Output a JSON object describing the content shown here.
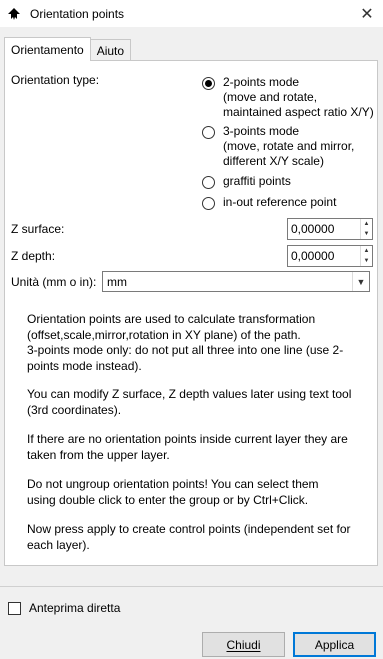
{
  "window": {
    "title": "Orientation points",
    "close_glyph": "✕"
  },
  "tabs": [
    {
      "label": "Orientamento"
    },
    {
      "label": "Aiuto"
    }
  ],
  "orientation": {
    "label": "Orientation type:",
    "options": [
      {
        "lines": [
          "2-points mode",
          "(move and rotate,",
          "maintained aspect ratio X/Y)"
        ],
        "selected": true
      },
      {
        "lines": [
          "3-points mode",
          "(move, rotate and mirror,",
          "different X/Y scale)"
        ],
        "selected": false
      },
      {
        "lines": [
          "graffiti points"
        ],
        "selected": false
      },
      {
        "lines": [
          "in-out reference point"
        ],
        "selected": false
      }
    ]
  },
  "z_surface": {
    "label": "Z surface:",
    "value": "0,00000"
  },
  "z_depth": {
    "label": "Z depth:",
    "value": "0,00000"
  },
  "unit": {
    "label": "Unità (mm o in):",
    "value": "mm"
  },
  "info": [
    "Orientation points are used to calculate transformation",
    "(offset,scale,mirror,rotation in XY plane) of the path.",
    "3-points mode only: do not put all three into one line (use 2-",
    "points mode instead).",
    "You can modify Z surface, Z depth values later using text tool",
    "(3rd coordinates).",
    "If there are no orientation points inside current layer they are",
    "taken from the upper layer.",
    "Do not ungroup orientation points! You can select them",
    "using double click to enter the group or by Ctrl+Click.",
    "Now press apply to create control points (independent set for",
    "each layer)."
  ],
  "preview": {
    "label": "Anteprima diretta",
    "checked": false
  },
  "buttons": {
    "close": "Chiudi",
    "apply": "Applica"
  }
}
